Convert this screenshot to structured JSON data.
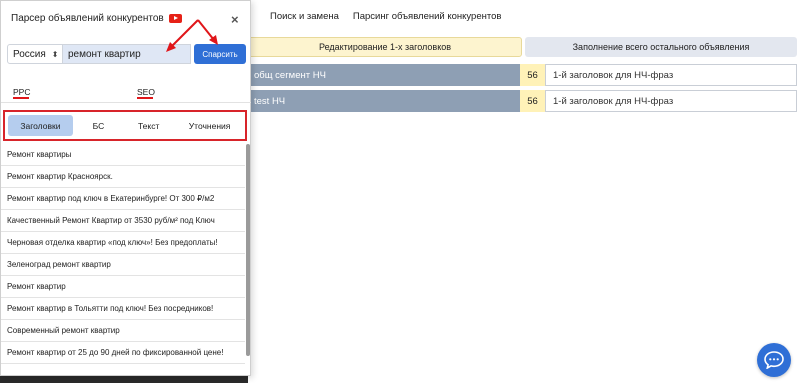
{
  "background": {
    "nav": [
      "Поиск и замена",
      "Парсинг объявлений конкурентов"
    ],
    "tabs": {
      "active": "Редактирование 1-х заголовков",
      "inactive": "Заполнение всего остального объявления"
    },
    "rows": [
      {
        "name": "общ сегмент НЧ",
        "count": "56",
        "header": "1-й заголовок для НЧ-фраз"
      },
      {
        "name": "test НЧ",
        "count": "56",
        "header": "1-й заголовок для НЧ-фраз"
      }
    ]
  },
  "panel": {
    "title": "Парсер объявлений конкурентов",
    "close": "×",
    "region": "Россия",
    "region_arrow": "⬍",
    "query": "ремонт квартир",
    "parse_button": "Спарсить",
    "subtabs": [
      "PPC",
      "SEO"
    ],
    "categories": [
      "Заголовки",
      "БС",
      "Текст",
      "Уточнения"
    ],
    "results": [
      "Ремонт квартиры",
      "Ремонт квартир Красноярск.",
      "Ремонт квартир под ключ в Екатеринбурге! От 300 ₽/м2",
      "Качественный Ремонт Квартир от 3530 руб/м² под Ключ",
      "Черновая отделка квартир «под ключ»! Без предоплаты!",
      "Зеленоград ремонт квартир",
      "Ремонт квартир",
      "Ремонт квартир в Тольятти под ключ! Без посредников!",
      "Современный ремонт квартир",
      "Ремонт квартир от 25 до 90 дней по фиксированной цене!"
    ]
  },
  "colors": {
    "accent": "#2f6fd6",
    "annotation": "#e0161a",
    "active_category": "#b5cdee"
  }
}
